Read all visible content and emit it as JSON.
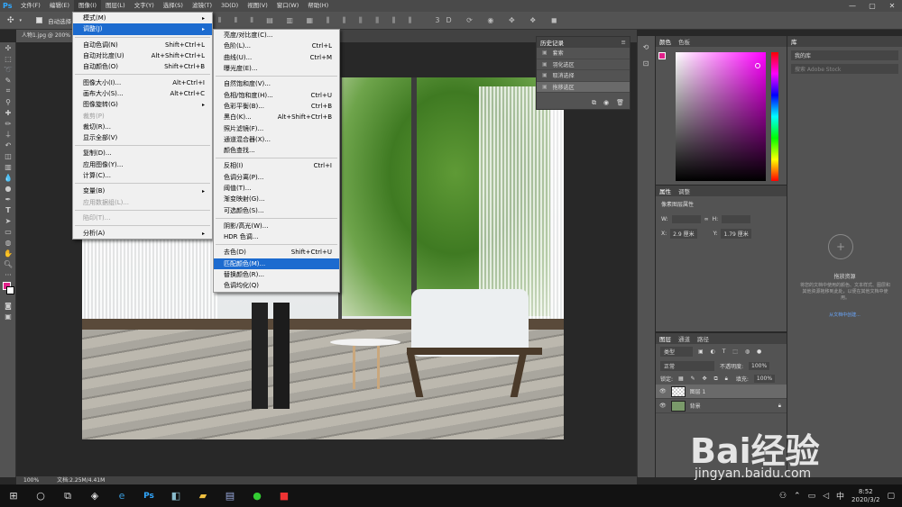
{
  "app": {
    "logo": "Ps",
    "min": "—",
    "max": "▢",
    "close": "✕"
  },
  "menubar": [
    "文件(F)",
    "编辑(E)",
    "图像(I)",
    "图层(L)",
    "文字(Y)",
    "选择(S)",
    "滤镜(T)",
    "3D(D)",
    "视图(V)",
    "窗口(W)",
    "帮助(H)"
  ],
  "options": {
    "auto_select": "自动选择："
  },
  "doc_tab": "人物1.jpg @ 200%",
  "status": {
    "zoom": "100%",
    "doc": "文档:2.25M/4.41M"
  },
  "image_menu": {
    "items": [
      {
        "label": "模式(M)",
        "shortcut": "",
        "sub": true
      },
      {
        "label": "调整(J)",
        "shortcut": "",
        "sub": true,
        "highlight": true,
        "sep_after": true
      },
      {
        "label": "自动色调(N)",
        "shortcut": "Shift+Ctrl+L"
      },
      {
        "label": "自动对比度(U)",
        "shortcut": "Alt+Shift+Ctrl+L"
      },
      {
        "label": "自动颜色(O)",
        "shortcut": "Shift+Ctrl+B",
        "sep_after": true
      },
      {
        "label": "图像大小(I)...",
        "shortcut": "Alt+Ctrl+I"
      },
      {
        "label": "画布大小(S)...",
        "shortcut": "Alt+Ctrl+C"
      },
      {
        "label": "图像旋转(G)",
        "shortcut": "",
        "sub": true
      },
      {
        "label": "裁剪(P)",
        "shortcut": "",
        "disabled": true
      },
      {
        "label": "裁切(R)...",
        "shortcut": ""
      },
      {
        "label": "显示全部(V)",
        "shortcut": "",
        "sep_after": true
      },
      {
        "label": "复制(D)...",
        "shortcut": ""
      },
      {
        "label": "应用图像(Y)...",
        "shortcut": ""
      },
      {
        "label": "计算(C)...",
        "shortcut": "",
        "sep_after": true
      },
      {
        "label": "变量(B)",
        "shortcut": "",
        "sub": true
      },
      {
        "label": "应用数据组(L)...",
        "shortcut": "",
        "disabled": true,
        "sep_after": true
      },
      {
        "label": "陷印(T)...",
        "shortcut": "",
        "disabled": true,
        "sep_after": true
      },
      {
        "label": "分析(A)",
        "shortcut": "",
        "sub": true
      }
    ]
  },
  "adjust_menu": {
    "items": [
      {
        "label": "亮度/对比度(C)...",
        "shortcut": ""
      },
      {
        "label": "色阶(L)...",
        "shortcut": "Ctrl+L"
      },
      {
        "label": "曲线(U)...",
        "shortcut": "Ctrl+M"
      },
      {
        "label": "曝光度(E)...",
        "shortcut": "",
        "sep_after": true
      },
      {
        "label": "自然饱和度(V)...",
        "shortcut": ""
      },
      {
        "label": "色相/饱和度(H)...",
        "shortcut": "Ctrl+U"
      },
      {
        "label": "色彩平衡(B)...",
        "shortcut": "Ctrl+B"
      },
      {
        "label": "黑白(K)...",
        "shortcut": "Alt+Shift+Ctrl+B"
      },
      {
        "label": "照片滤镜(F)...",
        "shortcut": ""
      },
      {
        "label": "通道混合器(X)...",
        "shortcut": ""
      },
      {
        "label": "颜色查找...",
        "shortcut": "",
        "sep_after": true
      },
      {
        "label": "反相(I)",
        "shortcut": "Ctrl+I"
      },
      {
        "label": "色调分离(P)...",
        "shortcut": ""
      },
      {
        "label": "阈值(T)...",
        "shortcut": ""
      },
      {
        "label": "渐变映射(G)...",
        "shortcut": ""
      },
      {
        "label": "可选颜色(S)...",
        "shortcut": "",
        "sep_after": true
      },
      {
        "label": "阴影/高光(W)...",
        "shortcut": ""
      },
      {
        "label": "HDR 色调...",
        "shortcut": "",
        "sep_after": true
      },
      {
        "label": "去色(D)",
        "shortcut": "Shift+Ctrl+U"
      },
      {
        "label": "匹配颜色(M)...",
        "shortcut": "",
        "highlight": true
      },
      {
        "label": "替换颜色(R)...",
        "shortcut": ""
      },
      {
        "label": "色调均化(Q)",
        "shortcut": ""
      }
    ]
  },
  "history": {
    "tab": "历史记录",
    "items": [
      "套索",
      "羽化选区",
      "取消选择",
      "拖移选区"
    ]
  },
  "color_panel": {
    "tab1": "颜色",
    "tab2": "色板",
    "fg": "#e0218a"
  },
  "library": {
    "tab": "库",
    "lib_name": "我的库",
    "search": "搜索 Adobe Stock",
    "title": "拖放资源",
    "desc": "将您的文档中使用的颜色、文本样式、图层和其他资源拖移到此处，以便在其他文档中使用。",
    "link": "从文档中创建..."
  },
  "properties": {
    "tab1": "属性",
    "tab2": "调整",
    "title": "像素图层属性",
    "w": "W:",
    "h": "H:",
    "x_label": "X:",
    "x": "2.9 厘米",
    "y_label": "Y:",
    "y": "1.79 厘米"
  },
  "layers": {
    "tabs": [
      "图层",
      "通道",
      "路径"
    ],
    "kind": "类型",
    "mode": "正常",
    "opacity_label": "不透明度:",
    "opacity": "100%",
    "lock_label": "锁定:",
    "fill_label": "填充:",
    "fill": "100%",
    "list": [
      {
        "name": "图层 1",
        "selected": true
      },
      {
        "name": "背景",
        "selected": false
      }
    ]
  },
  "taskbar": {
    "time": "8:52",
    "date": "2020/3/2"
  },
  "watermark": {
    "text": "Bai经验",
    "url": "jingyan.baidu.com"
  }
}
